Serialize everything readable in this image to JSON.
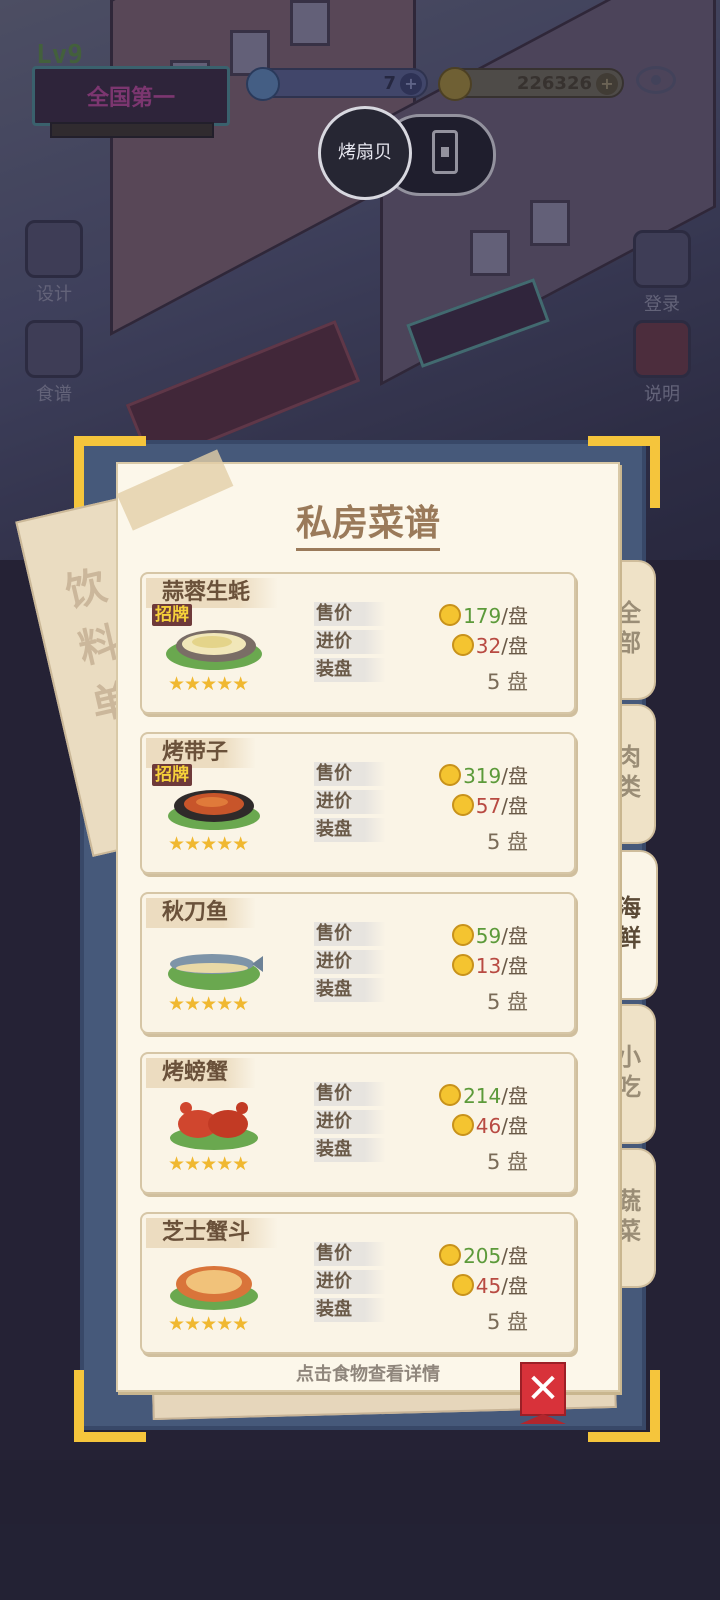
{
  "hud": {
    "level": "Lv9",
    "rank_title": "全国第一",
    "gems": "7",
    "coins": "226326",
    "circle_button": "烤扇贝",
    "colors": {
      "neon": "#4f8d95",
      "rank_text": "#b44b9a"
    }
  },
  "side_menu": {
    "left": [
      "设计",
      "食谱"
    ],
    "right": [
      "登录",
      "说明"
    ]
  },
  "menu": {
    "title": "私房菜谱",
    "drink_label": "饮料单",
    "hint": "点击食物查看详情",
    "close_icon": "close-icon",
    "labels": {
      "sell": "售价",
      "cost": "进价",
      "plate": "装盘"
    },
    "unit_plate": "/盘",
    "tabs": [
      {
        "label": "全部",
        "active": false
      },
      {
        "label": "肉类",
        "active": false
      },
      {
        "label": "海鲜",
        "active": true
      },
      {
        "label": "小吃",
        "active": false
      },
      {
        "label": "蔬菜",
        "active": false
      }
    ],
    "items": [
      {
        "name": "蒜蓉生蚝",
        "signature": "招牌",
        "stars": 5,
        "sell": "179",
        "cost": "32",
        "plate": "5 盘"
      },
      {
        "name": "烤带子",
        "signature": "招牌",
        "stars": 5,
        "sell": "319",
        "cost": "57",
        "plate": "5 盘"
      },
      {
        "name": "秋刀鱼",
        "signature": "",
        "stars": 5,
        "sell": "59",
        "cost": "13",
        "plate": "5 盘"
      },
      {
        "name": "烤螃蟹",
        "signature": "",
        "stars": 5,
        "sell": "214",
        "cost": "46",
        "plate": "5 盘"
      },
      {
        "name": "芝士蟹斗",
        "signature": "",
        "stars": 5,
        "sell": "205",
        "cost": "45",
        "plate": "5 盘"
      }
    ]
  }
}
